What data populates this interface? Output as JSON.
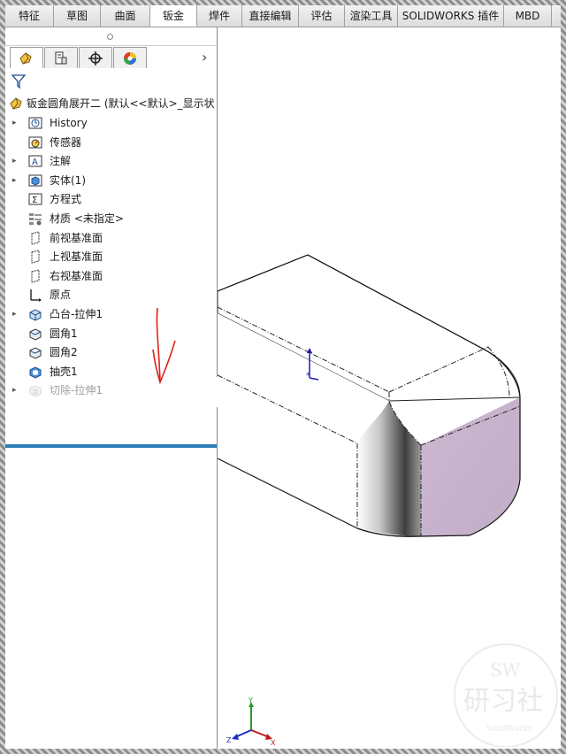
{
  "tabs": [
    {
      "label": "特征",
      "width": 55
    },
    {
      "label": "草图",
      "width": 53
    },
    {
      "label": "曲面",
      "width": 56
    },
    {
      "label": "钣金",
      "width": 53,
      "active": true
    },
    {
      "label": "焊件",
      "width": 51
    },
    {
      "label": "直接编辑",
      "width": 64
    },
    {
      "label": "评估",
      "width": 52
    },
    {
      "label": "渲染工具",
      "width": 60
    },
    {
      "label": "SOLIDWORKS 插件",
      "width": 120
    },
    {
      "label": "MBD",
      "width": 54
    }
  ],
  "panel_tabs": [
    "feature-manager-icon",
    "property-manager-icon",
    "configuration-manager-icon",
    "appearance-icon"
  ],
  "tree": {
    "root": "钣金圆角展开二  (默认<<默认>_显示状",
    "items": [
      {
        "label": "History",
        "icon": "history-icon",
        "expand": true
      },
      {
        "label": "传感器",
        "icon": "sensor-icon",
        "expand": false
      },
      {
        "label": "注解",
        "icon": "annotation-icon",
        "expand": true
      },
      {
        "label": "实体(1)",
        "icon": "solid-bodies-icon",
        "expand": true
      },
      {
        "label": "方程式",
        "icon": "equations-icon",
        "expand": false
      },
      {
        "label": "材质 <未指定>",
        "icon": "material-icon",
        "expand": false
      },
      {
        "label": "前视基准面",
        "icon": "plane-icon",
        "expand": false
      },
      {
        "label": "上视基准面",
        "icon": "plane-icon",
        "expand": false
      },
      {
        "label": "右视基准面",
        "icon": "plane-icon",
        "expand": false
      },
      {
        "label": "原点",
        "icon": "origin-icon",
        "expand": false
      },
      {
        "label": "凸台-拉伸1",
        "icon": "boss-extrude-icon",
        "expand": true
      },
      {
        "label": "圆角1",
        "icon": "fillet-icon",
        "expand": false
      },
      {
        "label": "圆角2",
        "icon": "fillet-icon",
        "expand": false
      },
      {
        "label": "抽壳1",
        "icon": "shell-icon",
        "expand": false
      },
      {
        "label": "切除-拉伸1",
        "icon": "cut-extrude-icon",
        "expand": true,
        "suppressed": true
      }
    ]
  },
  "triad": {
    "x": "X",
    "y": "Y",
    "z": "Z"
  },
  "watermark": {
    "line1": "SW",
    "line2": "研习社",
    "line3": "SolidWorks"
  },
  "colors": {
    "rollback_bar": "#2a7fb8",
    "annotation_arrow": "#e0201a",
    "face_tint": "#c7b3cc"
  }
}
